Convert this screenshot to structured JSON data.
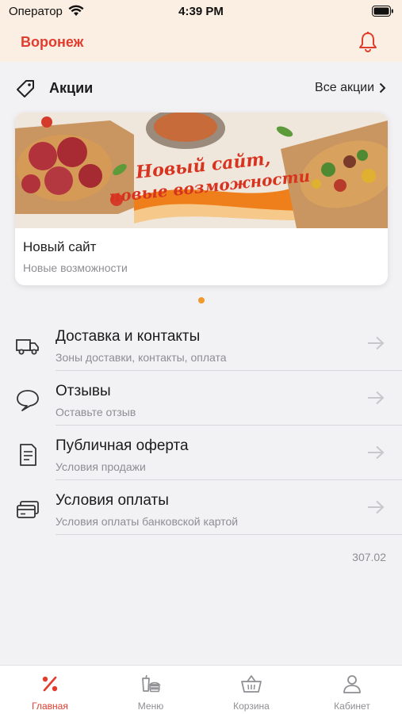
{
  "status_bar": {
    "carrier": "Оператор",
    "time": "4:39 PM"
  },
  "header": {
    "city": "Воронеж"
  },
  "promos": {
    "title": "Акции",
    "all_link": "Все акции",
    "card": {
      "banner_text_line1": "Новый сайт,",
      "banner_text_line2": "новые возможности",
      "title": "Новый сайт",
      "subtitle": "Новые возможности"
    },
    "carousel": {
      "count": 1,
      "active_index": 0
    }
  },
  "menu": {
    "items": [
      {
        "label": "Доставка и контакты",
        "sub": "Зоны доставки, контакты, оплата",
        "icon": "truck-icon"
      },
      {
        "label": "Отзывы",
        "sub": "Оставьте отзыв",
        "icon": "speech-bubble-icon"
      },
      {
        "label": "Публичная оферта",
        "sub": "Условия продажи",
        "icon": "document-icon"
      },
      {
        "label": "Условия оплаты",
        "sub": "Условия оплаты банковской картой",
        "icon": "cards-icon"
      }
    ]
  },
  "version": "307.02",
  "tabs": [
    {
      "label": "Главная",
      "icon": "percent-icon",
      "active": true
    },
    {
      "label": "Меню",
      "icon": "menu-food-icon",
      "active": false
    },
    {
      "label": "Корзина",
      "icon": "basket-icon",
      "active": false
    },
    {
      "label": "Кабинет",
      "icon": "person-icon",
      "active": false
    }
  ],
  "colors": {
    "accent": "#e23c2e",
    "header_bg": "#fbeee2",
    "carousel_dot": "#f29a2e",
    "page_bg": "#f2f2f4",
    "muted": "#8e8e93"
  }
}
